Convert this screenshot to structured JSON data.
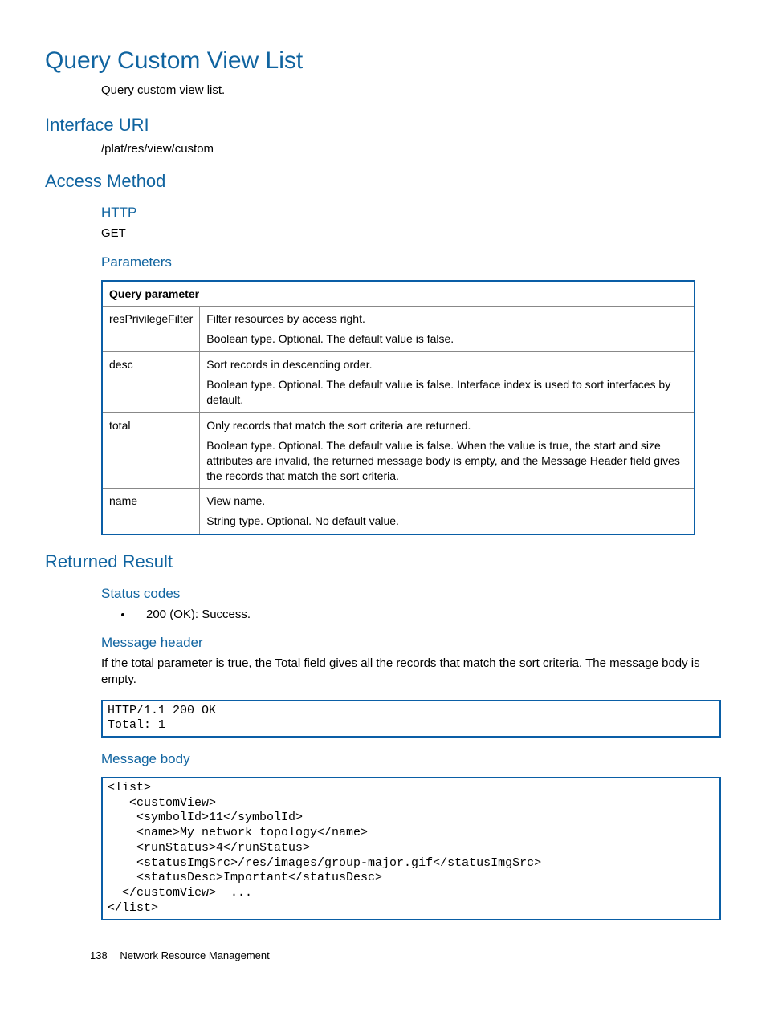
{
  "title": "Query Custom View List",
  "intro": "Query custom view list.",
  "sections": {
    "interface_uri": {
      "heading": "Interface URI",
      "value": "/plat/res/view/custom"
    },
    "access_method": {
      "heading": "Access Method",
      "http_heading": "HTTP",
      "http_value": "GET",
      "parameters_heading": "Parameters",
      "table_header": "Query parameter",
      "params": [
        {
          "name": "resPrivilegeFilter",
          "lines": [
            "Filter resources by access right.",
            "Boolean type. Optional. The default value is false."
          ]
        },
        {
          "name": "desc",
          "lines": [
            "Sort records in descending order.",
            "Boolean type. Optional. The default value is false. Interface index is used to sort interfaces by default."
          ]
        },
        {
          "name": "total",
          "lines": [
            "Only records that match the sort criteria are returned.",
            "Boolean type. Optional. The default value is false. When the value is true, the start and size attributes are invalid, the returned message body is empty, and the Message Header field gives the records that match the sort criteria."
          ]
        },
        {
          "name": "name",
          "lines": [
            "View name.",
            "String type. Optional. No default value."
          ]
        }
      ]
    },
    "returned_result": {
      "heading": "Returned Result",
      "status_codes_heading": "Status codes",
      "status_codes": [
        "200 (OK): Success."
      ],
      "message_header_heading": "Message header",
      "message_header_text": "If the total parameter is true, the Total field gives all the records that match the sort criteria. The message body is empty.",
      "message_header_code": "HTTP/1.1 200 OK\nTotal: 1",
      "message_body_heading": "Message body",
      "message_body_code": "<list>\n   <customView>\n    <symbolId>11</symbolId>\n    <name>My network topology</name>\n    <runStatus>4</runStatus>\n    <statusImgSrc>/res/images/group-major.gif</statusImgSrc>\n    <statusDesc>Important</statusDesc>\n  </customView>  ...\n</list>"
    }
  },
  "footer": {
    "page": "138",
    "section": "Network Resource Management"
  }
}
